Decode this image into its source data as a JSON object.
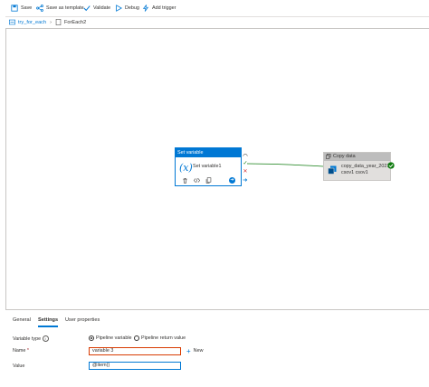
{
  "toolbar": {
    "save": "Save",
    "save_template": "Save as template",
    "validate": "Validate",
    "debug": "Debug",
    "add_trigger": "Add trigger"
  },
  "breadcrumb": {
    "pipeline": "try_for_each",
    "activity": "ForEach2"
  },
  "set_variable_activity": {
    "type_label": "Set variable",
    "icon_text": "(x)",
    "name": "Set variable1"
  },
  "copy_activity": {
    "type_label": "Copy data",
    "name": "copy_data_year_2021 csov1 csov1"
  },
  "tabs": [
    "General",
    "Settings",
    "User properties"
  ],
  "settings": {
    "variable_type_label": "Variable type",
    "variable_type_options": [
      "Pipeline variable",
      "Pipeline return value"
    ],
    "variable_type_selected": "Pipeline variable",
    "name_label": "Name",
    "name_required": "*",
    "name_value": "variable 3",
    "new_label": "New",
    "value_label": "Value",
    "value_value": "@item()"
  },
  "colors": {
    "accent": "#0078d4",
    "success": "#107c10",
    "error": "#d13438"
  }
}
